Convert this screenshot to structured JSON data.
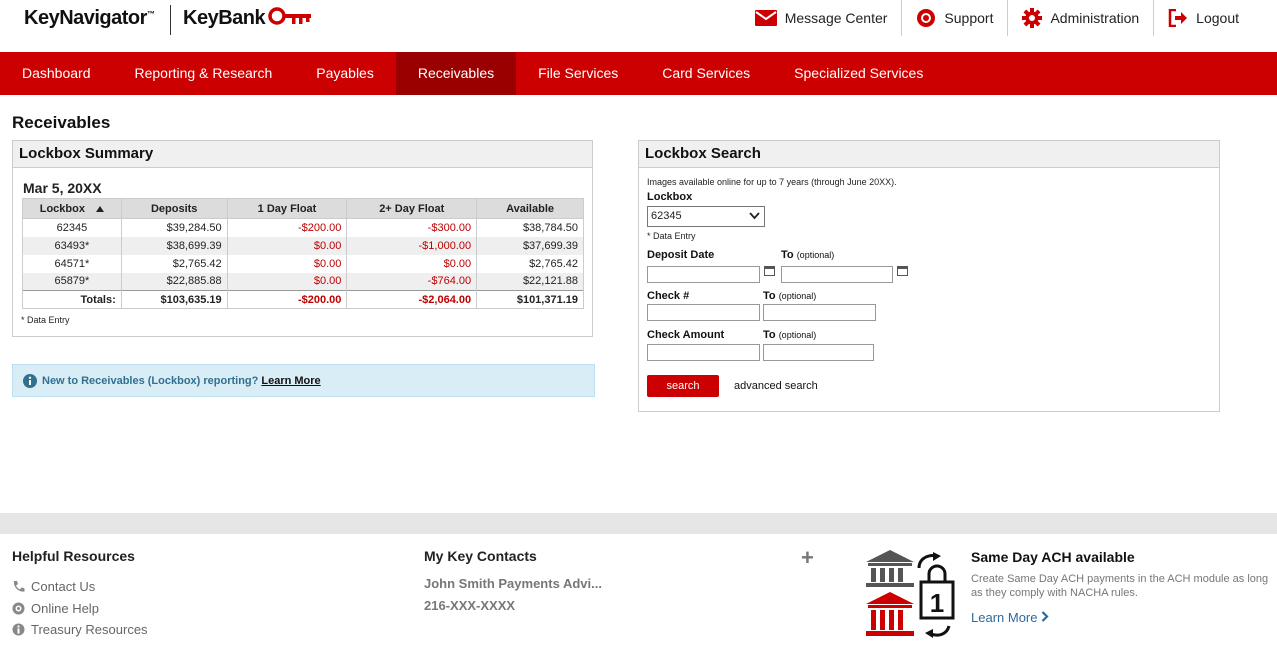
{
  "header": {
    "app_name": "KeyNavigator",
    "app_tm": "™",
    "bank_name": "KeyBank",
    "links": {
      "message_center": "Message Center",
      "support": "Support",
      "administration": "Administration",
      "logout": "Logout"
    }
  },
  "nav": [
    "Dashboard",
    "Reporting & Research",
    "Payables",
    "Receivables",
    "File Services",
    "Card Services",
    "Specialized Services"
  ],
  "nav_active": "Receivables",
  "page_title": "Receivables",
  "summary": {
    "title": "Lockbox Summary",
    "date": "Mar 5, 20XX",
    "columns": [
      "Lockbox",
      "Deposits",
      "1 Day Float",
      "2+ Day Float",
      "Available"
    ],
    "rows": [
      [
        "62345",
        "$39,284.50",
        "-$200.00",
        "-$300.00",
        "$38,784.50"
      ],
      [
        "63493*",
        "$38,699.39",
        "$0.00",
        "-$1,000.00",
        "$37,699.39"
      ],
      [
        "64571*",
        "$2,765.42",
        "$0.00",
        "$0.00",
        "$2,765.42"
      ],
      [
        "65879*",
        "$22,885.88",
        "$0.00",
        "-$764.00",
        "$22,121.88"
      ]
    ],
    "totals": [
      "Totals:",
      "$103,635.19",
      "-$200.00",
      "-$2,064.00",
      "$101,371.19"
    ],
    "note": "* Data Entry"
  },
  "info_bar": {
    "text": "New to Receivables (Lockbox) reporting?",
    "link": "Learn More"
  },
  "search": {
    "title": "Lockbox Search",
    "availability": "Images available online for up to 7 years (through June 20XX).",
    "lockbox_label": "Lockbox",
    "lockbox_value": "62345",
    "data_entry_note": "* Data Entry",
    "deposit_date_label": "Deposit Date",
    "to_label": "To",
    "optional": "(optional)",
    "check_label": "Check #",
    "check_amount_label": "Check Amount",
    "search_button": "search",
    "advanced_link": "advanced search"
  },
  "footer": {
    "helpful_title": "Helpful Resources",
    "helpful_links": [
      "Contact Us",
      "Online Help",
      "Treasury Resources"
    ],
    "contacts_title": "My Key Contacts",
    "contact_name": "John Smith Payments Advi...",
    "contact_phone": "216-XXX-XXXX",
    "plus": "+",
    "ach_title": "Same Day ACH available",
    "ach_desc": "Create Same Day ACH payments in the ACH module as long as they comply with NACHA rules.",
    "ach_link": "Learn More",
    "ach_icon_digit": "1"
  },
  "colors": {
    "brand_red": "#cc0000",
    "nav_active": "#9b0000",
    "negative": "#c00000",
    "info_bg": "#d9edf7",
    "info_text": "#31708f",
    "link_blue": "#2a6a9e"
  },
  "icons": [
    "envelope-icon",
    "lifebuoy-icon",
    "gear-icon",
    "logout-icon",
    "key-icon",
    "sort-up-icon",
    "info-icon",
    "chevron-down-icon",
    "calendar-icon",
    "phone-icon",
    "help-icon",
    "info-circle-icon",
    "bank-icon",
    "calendar-lock-icon",
    "chevron-right-icon"
  ]
}
